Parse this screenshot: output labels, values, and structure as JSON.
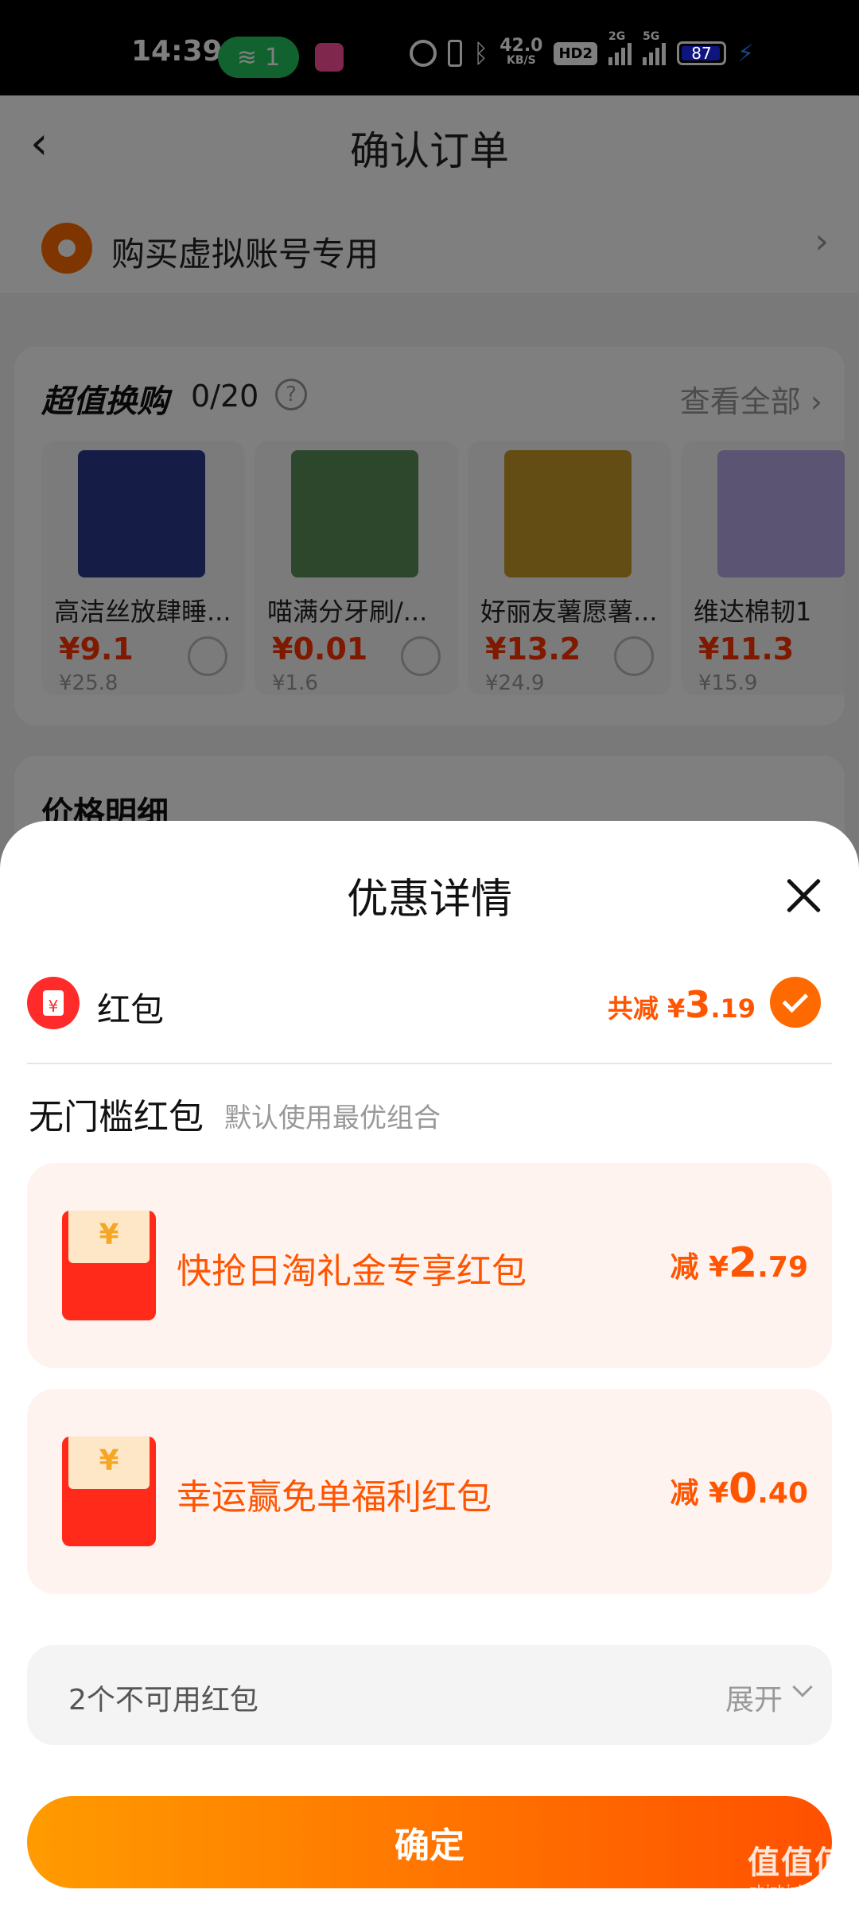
{
  "status_bar": {
    "time": "14:39",
    "wifi_badge": "1",
    "net_speed": "42.0",
    "net_unit": "KB/S",
    "hd": "HD2",
    "sig1": "2G",
    "sig2": "5G",
    "battery": "87"
  },
  "nav": {
    "back_icon": "chevron-left-icon",
    "title": "确认订单"
  },
  "address": {
    "text": "购买虚拟账号专用"
  },
  "deals": {
    "title": "超值换购",
    "count": "0/20",
    "help": "?",
    "view_all": "查看全部",
    "products": [
      {
        "name": "高洁丝放肆睡...",
        "price": "¥9.1",
        "orig_price": "¥25.8",
        "img_color": "#2b3a8f"
      },
      {
        "name": "喵满分牙刷/...",
        "price": "¥0.01",
        "orig_price": "¥1.6",
        "img_color": "#5b8f5a"
      },
      {
        "name": "好丽友薯愿薯...",
        "price": "¥13.2",
        "orig_price": "¥24.9",
        "img_color": "#c89b2a"
      },
      {
        "name": "维达棉韧1",
        "price": "¥11.3",
        "orig_price": "¥15.9",
        "img_color": "#b9a9e6"
      }
    ]
  },
  "price_detail": {
    "title": "价格明细"
  },
  "sheet": {
    "title": "优惠详情",
    "hongbao_label": "红包",
    "total_prefix": "共减 ¥",
    "total_int": "3",
    "total_dec": ".19",
    "section_title": "无门槛红包",
    "section_sub": "默认使用最优组合",
    "coupons": [
      {
        "name": "快抢日淘礼金专享红包",
        "prefix": "减 ¥",
        "int": "2",
        "dec": ".79"
      },
      {
        "name": "幸运赢免单福利红包",
        "prefix": "减 ¥",
        "int": "0",
        "dec": ".40"
      }
    ],
    "unavailable": "2个不可用红包",
    "expand": "展开",
    "confirm": "确定"
  },
  "watermark": {
    "main": "值值值",
    "sub": "zhizhizhi.com"
  }
}
